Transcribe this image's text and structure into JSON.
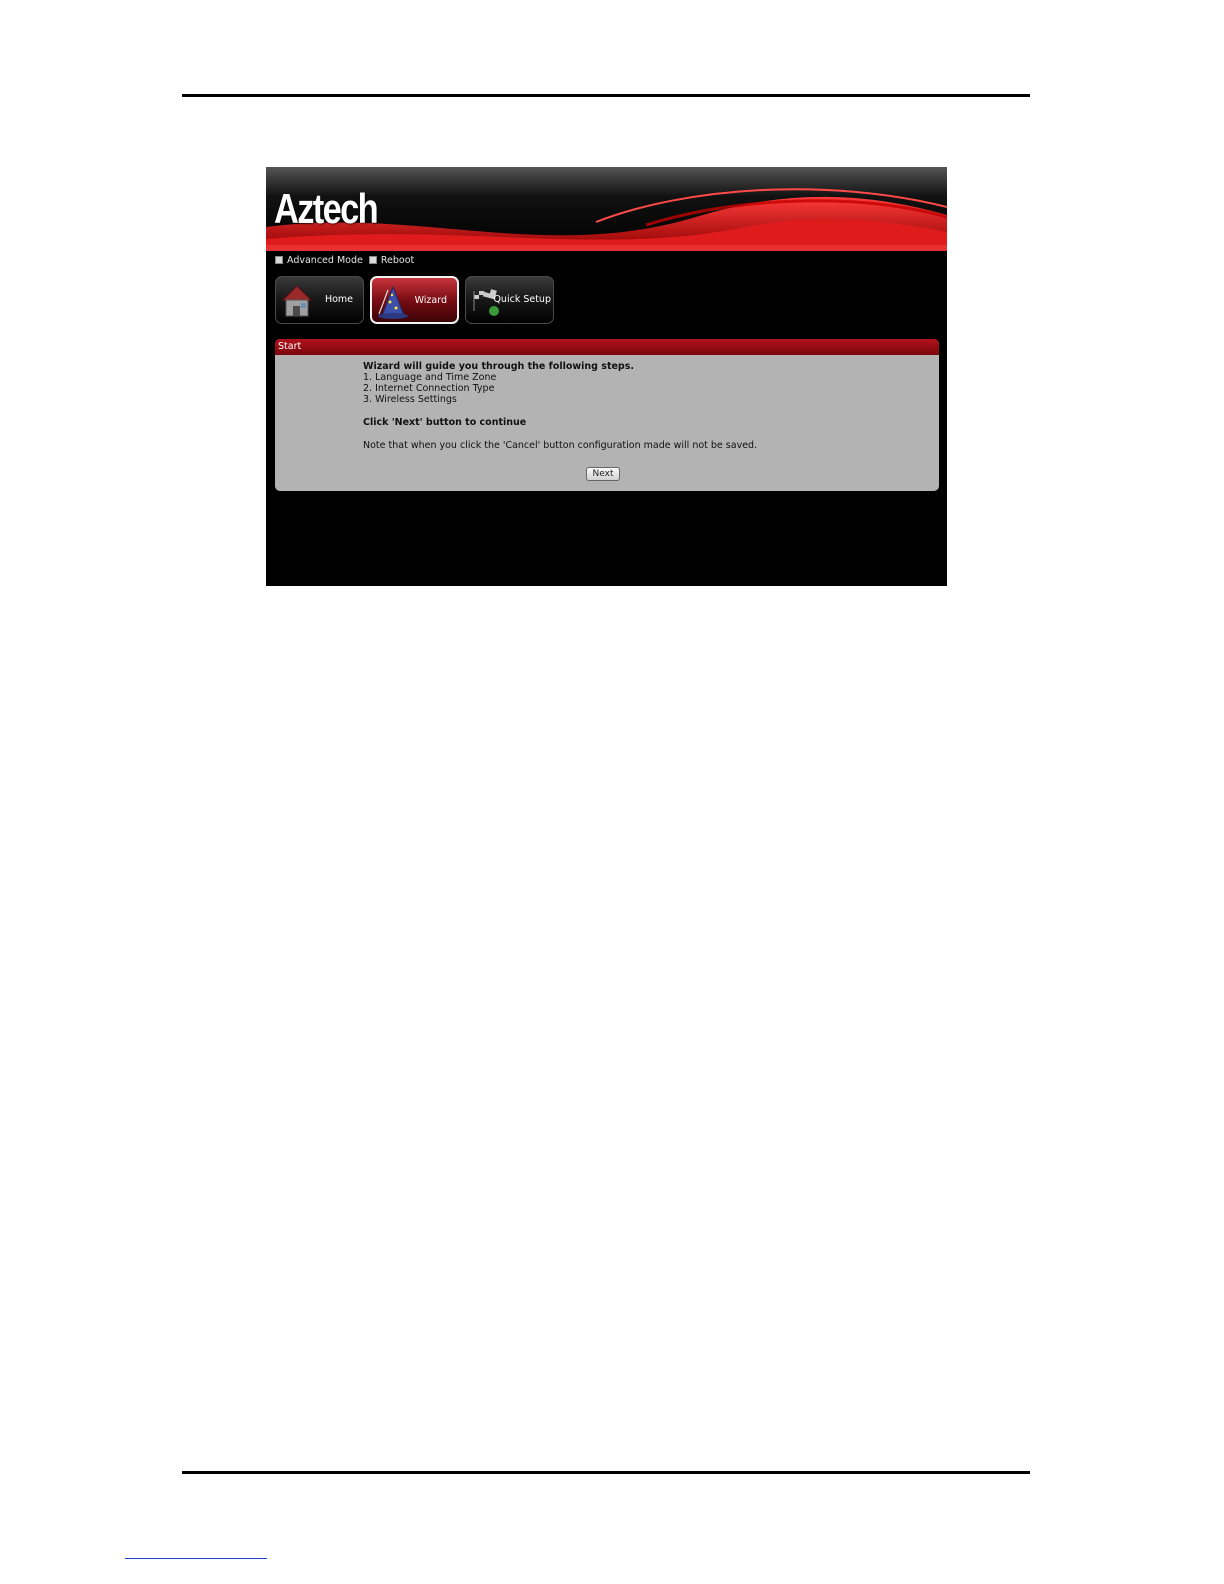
{
  "brand": {
    "logo": "Aztech"
  },
  "topnav": {
    "advanced_mode": "Advanced Mode",
    "reboot": "Reboot"
  },
  "tiles": {
    "home": "Home",
    "wizard": "Wizard",
    "quick_setup": "Quick Setup"
  },
  "panel": {
    "title": "Start",
    "intro": "Wizard will guide you through the following steps.",
    "steps": [
      "1. Language and Time Zone",
      "2. Internet Connection Type",
      "3. Wireless Settings"
    ],
    "instruction": "Click 'Next' button to continue",
    "note": "Note that when you click the 'Cancel' button configuration made will not be saved.",
    "next_label": "Next"
  }
}
